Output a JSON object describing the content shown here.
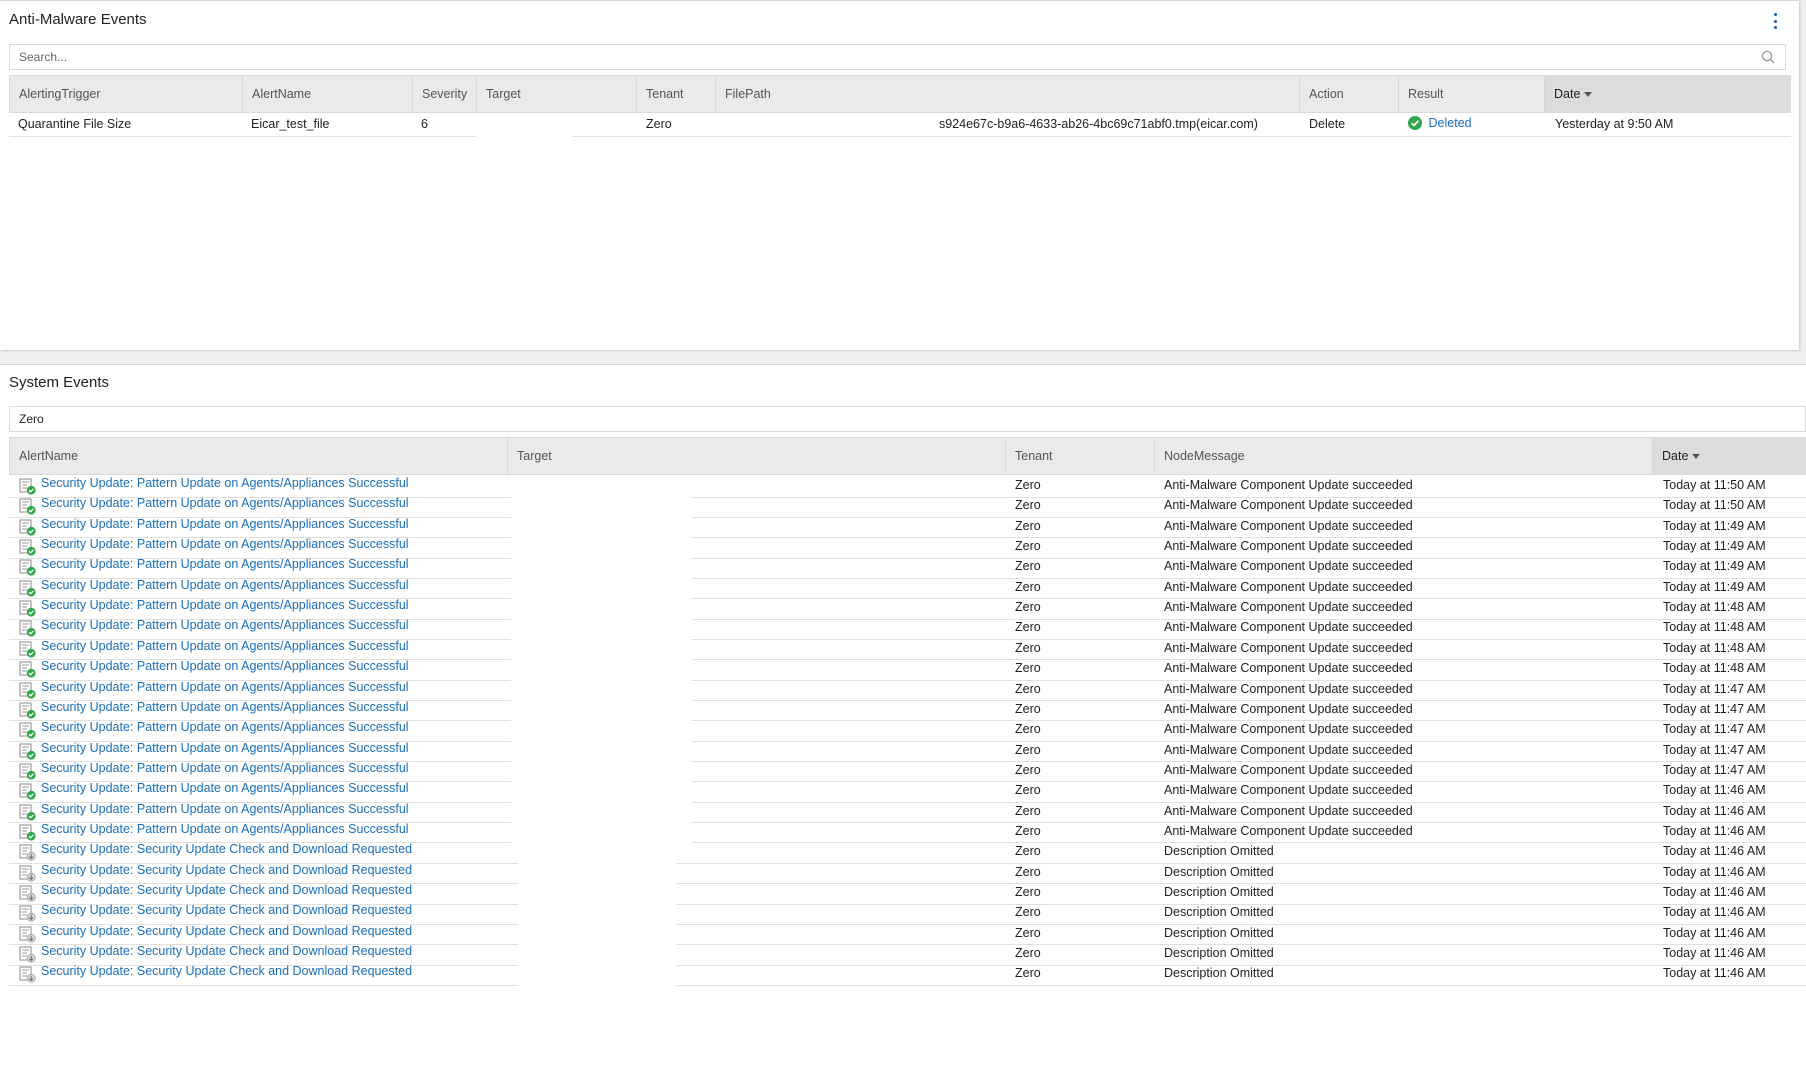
{
  "anti_malware": {
    "title": "Anti-Malware Events",
    "search_placeholder": "Search...",
    "columns": [
      "AlertingTrigger",
      "AlertName",
      "Severity",
      "Target",
      "Tenant",
      "FilePath",
      "Action",
      "Result",
      "Date"
    ],
    "rows": [
      {
        "alerting_trigger": "Quarantine File Size",
        "alert_name": "Eicar_test_file",
        "severity": "6",
        "target": "",
        "tenant": "Zero",
        "file_path": "s924e67c-b9a6-4633-ab26-4bc69c71abf0.tmp(eicar.com)",
        "action": "Delete",
        "result": "Deleted",
        "date": "Yesterday at 9:50 AM"
      }
    ]
  },
  "system_events": {
    "title": "System Events",
    "search_value": "Zero",
    "columns": [
      "AlertName",
      "Target",
      "Tenant",
      "NodeMessage",
      "Date"
    ],
    "rows": [
      {
        "alert_name": "Security Update: Pattern Update on Agents/Appliances Successful",
        "icon": "update-success-icon",
        "tenant": "Zero",
        "node_message": "Anti-Malware Component Update succeeded",
        "date": "Today at 11:50 AM"
      },
      {
        "alert_name": "Security Update: Pattern Update on Agents/Appliances Successful",
        "icon": "update-success-icon",
        "tenant": "Zero",
        "node_message": "Anti-Malware Component Update succeeded",
        "date": "Today at 11:50 AM"
      },
      {
        "alert_name": "Security Update: Pattern Update on Agents/Appliances Successful",
        "icon": "update-success-icon",
        "tenant": "Zero",
        "node_message": "Anti-Malware Component Update succeeded",
        "date": "Today at 11:49 AM"
      },
      {
        "alert_name": "Security Update: Pattern Update on Agents/Appliances Successful",
        "icon": "update-success-icon",
        "tenant": "Zero",
        "node_message": "Anti-Malware Component Update succeeded",
        "date": "Today at 11:49 AM"
      },
      {
        "alert_name": "Security Update: Pattern Update on Agents/Appliances Successful",
        "icon": "update-success-icon",
        "tenant": "Zero",
        "node_message": "Anti-Malware Component Update succeeded",
        "date": "Today at 11:49 AM"
      },
      {
        "alert_name": "Security Update: Pattern Update on Agents/Appliances Successful",
        "icon": "update-success-icon",
        "tenant": "Zero",
        "node_message": "Anti-Malware Component Update succeeded",
        "date": "Today at 11:49 AM"
      },
      {
        "alert_name": "Security Update: Pattern Update on Agents/Appliances Successful",
        "icon": "update-success-icon",
        "tenant": "Zero",
        "node_message": "Anti-Malware Component Update succeeded",
        "date": "Today at 11:48 AM"
      },
      {
        "alert_name": "Security Update: Pattern Update on Agents/Appliances Successful",
        "icon": "update-success-icon",
        "tenant": "Zero",
        "node_message": "Anti-Malware Component Update succeeded",
        "date": "Today at 11:48 AM"
      },
      {
        "alert_name": "Security Update: Pattern Update on Agents/Appliances Successful",
        "icon": "update-success-icon",
        "tenant": "Zero",
        "node_message": "Anti-Malware Component Update succeeded",
        "date": "Today at 11:48 AM"
      },
      {
        "alert_name": "Security Update: Pattern Update on Agents/Appliances Successful",
        "icon": "update-success-icon",
        "tenant": "Zero",
        "node_message": "Anti-Malware Component Update succeeded",
        "date": "Today at 11:48 AM"
      },
      {
        "alert_name": "Security Update: Pattern Update on Agents/Appliances Successful",
        "icon": "update-success-icon",
        "tenant": "Zero",
        "node_message": "Anti-Malware Component Update succeeded",
        "date": "Today at 11:47 AM"
      },
      {
        "alert_name": "Security Update: Pattern Update on Agents/Appliances Successful",
        "icon": "update-success-icon",
        "tenant": "Zero",
        "node_message": "Anti-Malware Component Update succeeded",
        "date": "Today at 11:47 AM"
      },
      {
        "alert_name": "Security Update: Pattern Update on Agents/Appliances Successful",
        "icon": "update-success-icon",
        "tenant": "Zero",
        "node_message": "Anti-Malware Component Update succeeded",
        "date": "Today at 11:47 AM"
      },
      {
        "alert_name": "Security Update: Pattern Update on Agents/Appliances Successful",
        "icon": "update-success-icon",
        "tenant": "Zero",
        "node_message": "Anti-Malware Component Update succeeded",
        "date": "Today at 11:47 AM"
      },
      {
        "alert_name": "Security Update: Pattern Update on Agents/Appliances Successful",
        "icon": "update-success-icon",
        "tenant": "Zero",
        "node_message": "Anti-Malware Component Update succeeded",
        "date": "Today at 11:47 AM"
      },
      {
        "alert_name": "Security Update: Pattern Update on Agents/Appliances Successful",
        "icon": "update-success-icon",
        "tenant": "Zero",
        "node_message": "Anti-Malware Component Update succeeded",
        "date": "Today at 11:46 AM"
      },
      {
        "alert_name": "Security Update: Pattern Update on Agents/Appliances Successful",
        "icon": "update-success-icon",
        "tenant": "Zero",
        "node_message": "Anti-Malware Component Update succeeded",
        "date": "Today at 11:46 AM"
      },
      {
        "alert_name": "Security Update: Pattern Update on Agents/Appliances Successful",
        "icon": "update-success-icon",
        "tenant": "Zero",
        "node_message": "Anti-Malware Component Update succeeded",
        "date": "Today at 11:46 AM"
      },
      {
        "alert_name": "Security Update: Security Update Check and Download Requested",
        "icon": "update-requested-icon",
        "tenant": "Zero",
        "node_message": "Description Omitted",
        "date": "Today at 11:46 AM"
      },
      {
        "alert_name": "Security Update: Security Update Check and Download Requested",
        "icon": "update-requested-icon",
        "tenant": "Zero",
        "node_message": "Description Omitted",
        "date": "Today at 11:46 AM"
      },
      {
        "alert_name": "Security Update: Security Update Check and Download Requested",
        "icon": "update-requested-icon",
        "tenant": "Zero",
        "node_message": "Description Omitted",
        "date": "Today at 11:46 AM"
      },
      {
        "alert_name": "Security Update: Security Update Check and Download Requested",
        "icon": "update-requested-icon",
        "tenant": "Zero",
        "node_message": "Description Omitted",
        "date": "Today at 11:46 AM"
      },
      {
        "alert_name": "Security Update: Security Update Check and Download Requested",
        "icon": "update-requested-icon",
        "tenant": "Zero",
        "node_message": "Description Omitted",
        "date": "Today at 11:46 AM"
      },
      {
        "alert_name": "Security Update: Security Update Check and Download Requested",
        "icon": "update-requested-icon",
        "tenant": "Zero",
        "node_message": "Description Omitted",
        "date": "Today at 11:46 AM"
      },
      {
        "alert_name": "Security Update: Security Update Check and Download Requested",
        "icon": "update-requested-icon",
        "tenant": "Zero",
        "node_message": "Description Omitted",
        "date": "Today at 11:46 AM"
      }
    ]
  },
  "colors": {
    "link": "#1a6fb8",
    "success_green": "#2ea84a",
    "header_bg": "#eaeaea",
    "sorted_header_bg": "#dcdcdc",
    "kebab": "#1a5fa8"
  }
}
